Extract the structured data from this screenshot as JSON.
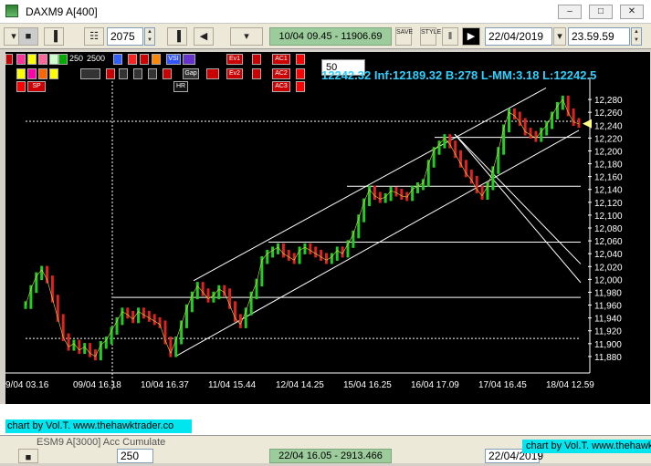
{
  "window": {
    "title": "DAXM9 A[400]"
  },
  "toolbar": {
    "bars_value": "2075",
    "time_range": "10/04 09.45 - 11906.69",
    "date_value": "22/04/2019",
    "time_value": "23.59.59",
    "btn_save": "SAVE",
    "btn_style": "STYLE"
  },
  "indicators": {
    "label_250": "250",
    "label_2500": "2500",
    "period_value": "50",
    "btn_hr": "HR",
    "btn_gap": "Gap",
    "btn_ev1": "Ev1",
    "btn_ev2": "Ev2",
    "btn_ac1": "AC1",
    "btn_ac2": "AC2",
    "btn_ac3": "AC3",
    "btn_vsi": "VSI",
    "btn_sp": "SP"
  },
  "info": {
    "text": "12242.32 Inf:12189.32 B:278 L-MM:3.18 L:12242.5"
  },
  "chart_data": {
    "type": "line",
    "title": "",
    "ylim": [
      11860,
      12300
    ],
    "y_ticks": [
      "12,280",
      "12,260",
      "12,240",
      "12,220",
      "12,200",
      "12,180",
      "12,160",
      "12,140",
      "12,120",
      "12,100",
      "12,080",
      "12,060",
      "12,040",
      "12,020",
      "12,000",
      "11,980",
      "11,960",
      "11,940",
      "11,920",
      "11,900",
      "11,880"
    ],
    "x_ticks": [
      "9/04 03.16",
      "09/04 16.18",
      "10/04 16.37",
      "11/04 15.44",
      "12/04 14.25",
      "15/04 16.25",
      "16/04 17.09",
      "17/04 16.45",
      "18/04 12.59"
    ],
    "grid": false,
    "series": [
      {
        "values": [
          11960,
          11985,
          12005,
          12015,
          12000,
          11970,
          11940,
          11910,
          11895,
          11900,
          11890,
          11895,
          11885,
          11880,
          11898,
          11905,
          11920,
          11935,
          11950,
          11945,
          11938,
          11950,
          11945,
          11940,
          11935,
          11930,
          11905,
          11885,
          11905,
          11930,
          11955,
          11975,
          11990,
          11980,
          11970,
          11975,
          11985,
          11980,
          11960,
          11940,
          11930,
          11950,
          11975,
          11995,
          12030,
          12040,
          12045,
          12050,
          12040,
          12035,
          12030,
          12045,
          12050,
          12045,
          12040,
          12035,
          12030,
          12035,
          12045,
          12040,
          12055,
          12070,
          12095,
          12120,
          12140,
          12130,
          12125,
          12128,
          12138,
          12135,
          12130,
          12128,
          12140,
          12145,
          12150,
          12180,
          12200,
          12210,
          12220,
          12210,
          12195,
          12180,
          12165,
          12155,
          12140,
          12130,
          12145,
          12170,
          12200,
          12235,
          12260,
          12255,
          12245,
          12230,
          12225,
          12220,
          12230,
          12240,
          12255,
          12270,
          12280,
          12260,
          12245,
          12242
        ]
      }
    ],
    "horizontal_levels": [
      12246,
      12221,
      12145,
      12058,
      11972,
      11908
    ],
    "current_price": 12242.32
  },
  "credits": {
    "main": "chart by Vol.T. www.thehawktrader.co",
    "secondary": "chart by Vol.T. www.thehawktrader.co"
  },
  "background_window": {
    "title": "ESM9 A[3000] Acc Cumulate",
    "bars_value": "250",
    "time_range": "22/04 16.05 - 2913.466",
    "date_value": "22/04/2019"
  }
}
